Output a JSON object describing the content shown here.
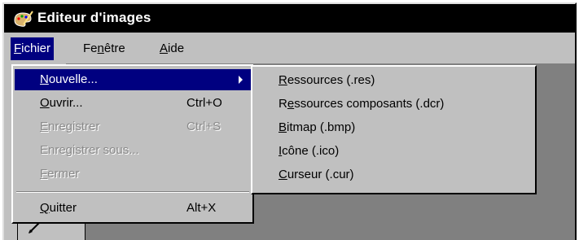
{
  "window": {
    "title": "Editeur d'images",
    "icon": "paint-palette-icon"
  },
  "menubar": {
    "items": [
      {
        "key": "fichier",
        "pre": "",
        "mnemonic": "F",
        "post": "ichier",
        "open": true
      },
      {
        "key": "fenetre",
        "pre": "Fe",
        "mnemonic": "n",
        "post": "être",
        "open": false
      },
      {
        "key": "aide",
        "pre": "",
        "mnemonic": "A",
        "post": "ide",
        "open": false
      }
    ]
  },
  "fichier_menu": {
    "items": [
      {
        "pre": "",
        "mnemonic": "N",
        "post": "ouvelle...",
        "shortcut": "",
        "enabled": true,
        "highlighted": true,
        "has_submenu": true
      },
      {
        "pre": "",
        "mnemonic": "O",
        "post": "uvrir...",
        "shortcut": "Ctrl+O",
        "enabled": true,
        "highlighted": false,
        "has_submenu": false
      },
      {
        "pre": "",
        "mnemonic": "E",
        "post": "nregistrer",
        "shortcut": "Ctrl+S",
        "enabled": false,
        "highlighted": false,
        "has_submenu": false
      },
      {
        "pre": "Enregistrer sous...",
        "mnemonic": "",
        "post": "",
        "shortcut": "",
        "enabled": false,
        "highlighted": false,
        "has_submenu": false
      },
      {
        "pre": "",
        "mnemonic": "F",
        "post": "ermer",
        "shortcut": "",
        "enabled": false,
        "highlighted": false,
        "has_submenu": false
      },
      {
        "pre": "",
        "mnemonic": "Q",
        "post": "uitter",
        "shortcut": "Alt+X",
        "enabled": true,
        "highlighted": false,
        "has_submenu": false
      }
    ]
  },
  "nouvelle_submenu": {
    "items": [
      {
        "pre": "",
        "mnemonic": "R",
        "post": "essources (.res)"
      },
      {
        "pre": "R",
        "mnemonic": "e",
        "post": "ssources composants (.dcr)"
      },
      {
        "pre": "",
        "mnemonic": "B",
        "post": "itmap (.bmp)"
      },
      {
        "pre": "",
        "mnemonic": "I",
        "post": "cône (.ico)"
      },
      {
        "pre": "",
        "mnemonic": "C",
        "post": "urseur (.cur)"
      }
    ]
  },
  "toolbox": {
    "icon": "pencil-icon"
  },
  "colors": {
    "titlebar": "#000000",
    "highlight": "#000080",
    "face": "#c0c0c0",
    "workspace": "#808080",
    "disabled_text": "#8a8a8a"
  }
}
